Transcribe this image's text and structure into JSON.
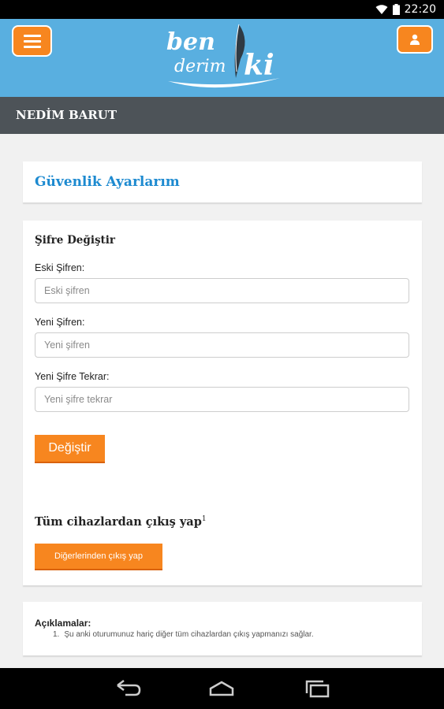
{
  "status": {
    "time": "22:20"
  },
  "header": {
    "logo_text_line1": "ben",
    "logo_text_line2": "derim",
    "logo_text_ki": "ki",
    "menu_icon": "hamburger-icon",
    "user_icon": "user-icon"
  },
  "profile": {
    "name": "NEDİM BARUT"
  },
  "page": {
    "title": "Güvenlik Ayarlarım"
  },
  "password_form": {
    "section_title": "Şifre Değiştir",
    "old_label": "Eski Şifren:",
    "old_placeholder": "Eski şifren",
    "new_label": "Yeni Şifren:",
    "new_placeholder": "Yeni şifren",
    "repeat_label": "Yeni Şifre Tekrar:",
    "repeat_placeholder": "Yeni şifre tekrar",
    "submit_label": "Değiştir"
  },
  "logout_section": {
    "title": "Tüm cihazlardan çıkış yap",
    "footnote": "1",
    "button_label": "Diğerlerinden çıkış yap"
  },
  "notes": {
    "title": "Açıklamalar:",
    "items": [
      {
        "num": "1.",
        "text": "Şu anki oturumunuz hariç diğer tüm cihazlardan çıkış yapmanızı sağlar."
      }
    ]
  },
  "colors": {
    "header_blue": "#59afe0",
    "accent_orange": "#f7861f",
    "title_blue": "#1d8ad0",
    "name_bar": "#4d5358"
  }
}
